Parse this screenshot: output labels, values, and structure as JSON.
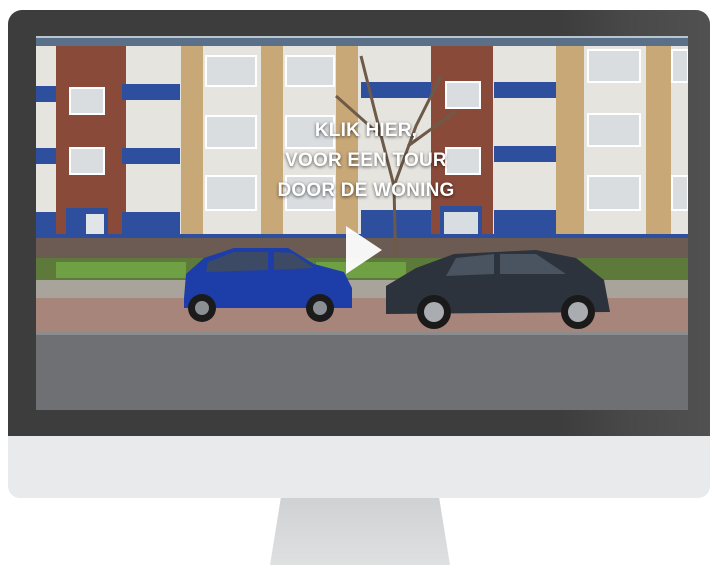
{
  "video": {
    "cta_lines": [
      "KLIK HIER,",
      "VOOR EEN TOUR",
      "DOOR DE WONING"
    ],
    "play_icon": "play-icon"
  },
  "colors": {
    "bezel": "#3d3d3d",
    "chin": "#e9eaeb",
    "stand": "#d6d8da",
    "brick": "#8a4a3a",
    "balcony_blue": "#2d4f9e",
    "blue_car": "#1d3ea8",
    "dark_car": "#2c333c"
  }
}
